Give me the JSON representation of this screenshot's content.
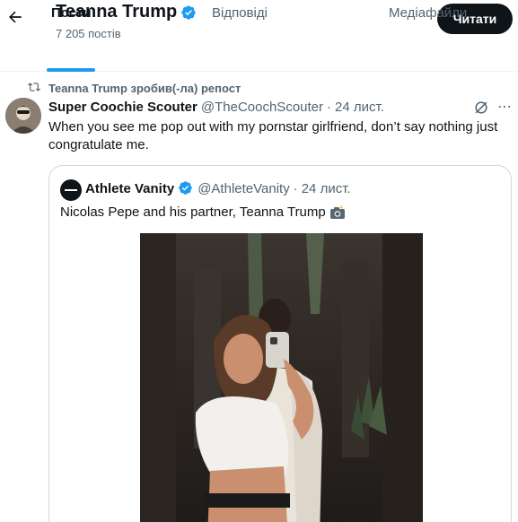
{
  "header": {
    "profile_name": "Teanna Trump",
    "post_count": "7 205 постів",
    "follow_label": "Читати"
  },
  "tabs": [
    {
      "label": "Пости",
      "active": true
    },
    {
      "label": "Відповіді",
      "active": false
    },
    {
      "label": "Медіафайли",
      "active": false
    }
  ],
  "repost": {
    "text": "Teanna Trump зробив(-ла) репост"
  },
  "tweet": {
    "author_name": "Super Coochie Scouter",
    "handle": "@TheCoochScouter",
    "separator": "·",
    "date": "24 лист.",
    "text": "When you see me pop out with my pornstar girlfriend, don’t say nothing just congratulate me."
  },
  "quote": {
    "author_name": "Athlete Vanity",
    "handle": "@AthleteVanity",
    "separator": "·",
    "date": "24 лист.",
    "text": "Nicolas Pepe and his partner, Teanna Trump",
    "emoji_icon": "camera-flash-icon"
  },
  "colors": {
    "accent": "#1d9bf0",
    "text": "#0f1419",
    "secondary": "#536471",
    "border": "#cfd9de"
  }
}
